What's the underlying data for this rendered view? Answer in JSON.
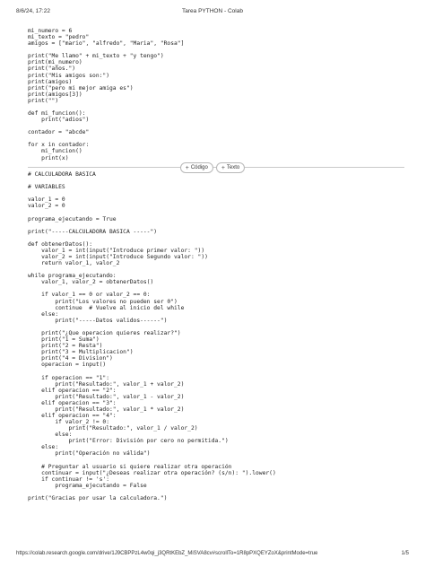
{
  "header": {
    "datetime": "8/6/24, 17:22",
    "title": "Tarea PYTHON - Colab"
  },
  "footer": {
    "url": "https://colab.research.google.com/drive/1J9CBPPzL4w0qi_j3QRtKEbZ_MiSVA8cv#scrollTo=1R8pPXQEYZoX&printMode=true",
    "page": "1/5"
  },
  "add_bar": {
    "plus_icon": "+",
    "code_label": "Código",
    "text_label": "Texto"
  },
  "cell1_lines": [
    "mi_numero = 6",
    "mi_texto = \"pedro\"",
    "amigos = [\"mario\", \"alfredo\", \"Maria\", \"Rosa\"]",
    "",
    "print(\"Me llamo\" + mi_texto + \"y tengo\")",
    "print(mi_numero)",
    "print(\"años.\")",
    "print(\"Mis amigos son:\")",
    "print(amigos)",
    "print(\"pero mi mejor amiga es\")",
    "print(amigos[3])",
    "print(\"\")",
    "",
    "def mi_funcion():",
    "    print(\"adios\")",
    "",
    "contador = \"abcde\"",
    "",
    "for x in contador:",
    "    mi_funcion()",
    "    print(x)"
  ],
  "cell2_lines": [
    "# CALCULADORA BASICA",
    "",
    "# VARIABLES",
    "",
    "valor_1 = 0",
    "valor_2 = 0",
    "",
    "programa_ejecutando = True",
    "",
    "print(\"-----CALCULADORA BASICA -----\")",
    "",
    "def obtenerDatos():",
    "    valor_1 = int(input(\"Introduce primer valor: \"))",
    "    valor_2 = int(input(\"Introduce Segundo valor: \"))",
    "    return valor_1, valor_2",
    "",
    "while programa_ejecutando:",
    "    valor_1, valor_2 = obtenerDatos()",
    "",
    "    if valor_1 == 0 or valor_2 == 0:",
    "        print(\"Los valores no pueden ser 0\")",
    "        continue  # Vuelve al inicio del while",
    "    else:",
    "        print(\"-----Datos validos------\")",
    "",
    "    print(\"¿Que operacion quieres realizar?\")",
    "    print(\"1 = Suma\")",
    "    print(\"2 = Resta\")",
    "    print(\"3 = Multiplicacion\")",
    "    print(\"4 = Division\")",
    "    operacion = input()",
    "",
    "    if operacion == \"1\":",
    "        print(\"Resultado:\", valor_1 + valor_2)",
    "    elif operacion == \"2\":",
    "        print(\"Resultado:\", valor_1 - valor_2)",
    "    elif operacion == \"3\":",
    "        print(\"Resultado:\", valor_1 * valor_2)",
    "    elif operacion == \"4\":",
    "        if valor_2 != 0:",
    "            print(\"Resultado:\", valor_1 / valor_2)",
    "        else:",
    "            print(\"Error: División por cero no permitida.\")",
    "    else:",
    "        print(\"Operación no válida\")",
    "",
    "    # Preguntar al usuario si quiere realizar otra operación",
    "    continuar = input(\"¿Deseas realizar otra operación? (s/n): \").lower()",
    "    if continuar != 's':",
    "        programa_ejecutando = False",
    "",
    "print(\"Gracias por usar la calculadora.\")"
  ]
}
